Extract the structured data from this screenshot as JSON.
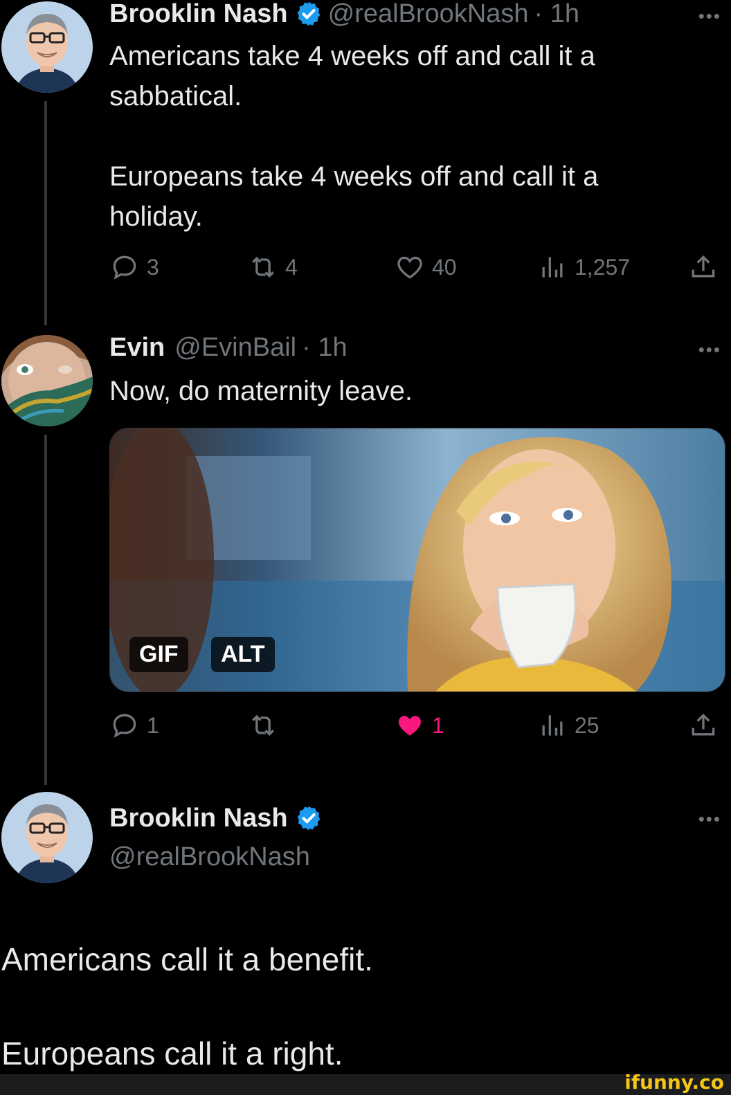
{
  "tweet1": {
    "name": "Brooklin Nash",
    "handle": "@realBrookNash",
    "time": "· 1h",
    "more": "•••",
    "text": "Americans take 4 weeks off and call it a\nsabbatical.\n\nEuropeans take 4 weeks off and call it a\nholiday.",
    "replies": "3",
    "reposts": "4",
    "likes": "40",
    "views": "1,257"
  },
  "tweet2": {
    "name": "Evin",
    "handle": "@EvinBail",
    "time": "· 1h",
    "more": "•••",
    "text": "Now, do maternity leave.",
    "media_badges": {
      "gif": "GIF",
      "alt": "ALT"
    },
    "replies": "1",
    "reposts": "",
    "likes": "1",
    "views": "25",
    "liked": true
  },
  "tweet3": {
    "name": "Brooklin Nash",
    "handle": "@realBrookNash",
    "more": "•••",
    "line1": "Americans call it a benefit.",
    "line2": "Europeans call it a right."
  },
  "watermark": "ifunny.co",
  "colors": {
    "background": "#000000",
    "text": "#e7e9ea",
    "muted": "#71767b",
    "verified": "#1d9bf0",
    "like": "#f91880"
  },
  "icons": [
    "reply-icon",
    "repost-icon",
    "like-icon",
    "views-icon",
    "share-icon",
    "verified-icon",
    "more-icon"
  ]
}
